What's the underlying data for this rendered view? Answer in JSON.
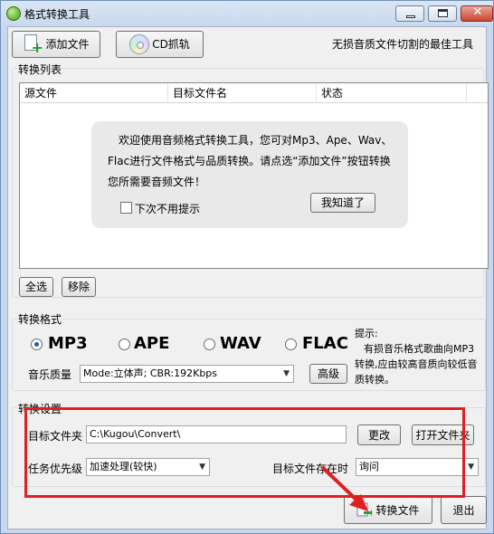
{
  "window": {
    "title": "格式转换工具",
    "controls": {
      "minimize": "",
      "maximize": "",
      "close": "✕"
    }
  },
  "toolbar": {
    "add_file_label": "添加文件",
    "cd_rip_label": "CD抓轨",
    "slogan": "无损音质文件切割的最佳工具"
  },
  "conversion_list": {
    "group_label": "转换列表",
    "columns": [
      "源文件",
      "目标文件名",
      "状态",
      ""
    ],
    "welcome_tip": {
      "text": "欢迎使用音频格式转换工具，您可对Mp3、Ape、Wav、Flac进行文件格式与品质转换。请点选“添加文件”按钮转换您所需要音频文件！",
      "dont_show_label": "下次不用提示",
      "dont_show_checked": false,
      "got_it_label": "我知道了"
    },
    "select_all_label": "全选",
    "remove_label": "移除"
  },
  "format": {
    "group_label": "转换格式",
    "options": [
      "MP3",
      "APE",
      "WAV",
      "FLAC"
    ],
    "selected": "MP3",
    "quality_label": "音乐质量",
    "quality_value": "Mode:立体声; CBR:192Kbps",
    "advanced_label": "高级",
    "hint_title": "提示:",
    "hint_body": "有损音乐格式歌曲向MP3转换,应由较高音质向较低音质转换。"
  },
  "settings": {
    "group_label": "转换设置",
    "target_folder_label": "目标文件夹",
    "target_folder_value": "C:\\Kugou\\Convert\\",
    "change_label": "更改",
    "open_folder_label": "打开文件夹",
    "priority_label": "任务优先级",
    "priority_value": "加速处理(较快)",
    "exists_label": "目标文件存在时",
    "exists_value": "询问"
  },
  "actions": {
    "convert_label": "转换文件",
    "exit_label": "退出"
  },
  "annotation": {
    "highlight_color": "#e02020"
  }
}
